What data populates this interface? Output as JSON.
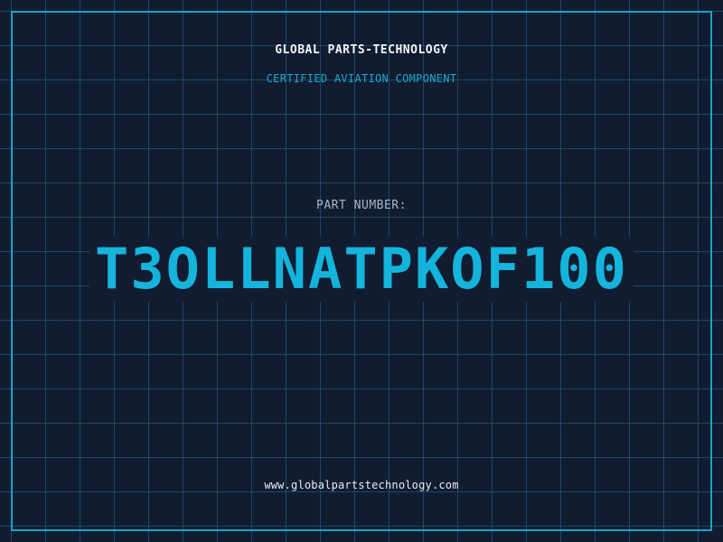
{
  "header": {
    "company": "GLOBAL PARTS-TECHNOLOGY",
    "subtitle": "CERTIFIED AVIATION COMPONENT"
  },
  "part": {
    "label": "PART NUMBER:",
    "number": "T3OLLNATPKOF100"
  },
  "footer": {
    "website": "www.globalpartstechnology.com"
  },
  "colors": {
    "background": "#121c31",
    "grid": "#1e6e8c",
    "accent": "#14b4dc",
    "text": "#f2f4f8"
  }
}
